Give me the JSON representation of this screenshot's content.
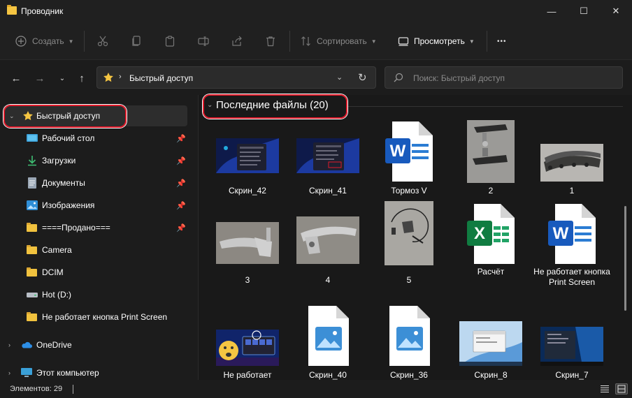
{
  "window": {
    "title": "Проводник",
    "minimize_glyph": "—",
    "maximize_glyph": "☐",
    "close_glyph": "✕"
  },
  "toolbar": {
    "create_label": "Создать",
    "sort_label": "Сортировать",
    "view_label": "Просмотреть",
    "more_glyph": "•••"
  },
  "address": {
    "path": "Быстрый доступ",
    "search_placeholder": "Поиск: Быстрый доступ"
  },
  "sidebar": {
    "quick_access": "Быстрый доступ",
    "items": [
      {
        "label": "Рабочий стол",
        "icon": "desktop-icon",
        "pinned": true
      },
      {
        "label": "Загрузки",
        "icon": "download-icon",
        "pinned": true
      },
      {
        "label": "Документы",
        "icon": "document-icon",
        "pinned": true
      },
      {
        "label": "Изображения",
        "icon": "pictures-icon",
        "pinned": true
      },
      {
        "label": "====Продано===",
        "icon": "folder-icon",
        "pinned": true
      },
      {
        "label": "Camera",
        "icon": "folder-icon",
        "pinned": false
      },
      {
        "label": "DCIM",
        "icon": "folder-icon",
        "pinned": false
      },
      {
        "label": "Hot (D:)",
        "icon": "drive-icon",
        "pinned": false
      },
      {
        "label": "Не работает кнопка Print Screen",
        "icon": "folder-icon",
        "pinned": false
      }
    ],
    "onedrive": "OneDrive",
    "this_pc": "Этот компьютер"
  },
  "content": {
    "group_title": "Последние файлы (20)",
    "files": [
      {
        "name": "Скрин_42",
        "kind": "screenshot"
      },
      {
        "name": "Скрин_41",
        "kind": "screenshot"
      },
      {
        "name": "Тормоз V",
        "kind": "word"
      },
      {
        "name": "2",
        "kind": "photo"
      },
      {
        "name": "1",
        "kind": "photo"
      },
      {
        "name": "3",
        "kind": "photo"
      },
      {
        "name": "4",
        "kind": "photo"
      },
      {
        "name": "5",
        "kind": "photo"
      },
      {
        "name": "Расчёт",
        "kind": "excel"
      },
      {
        "name": "Не работает кнопка Print Screen",
        "kind": "word"
      },
      {
        "name": "Не работает",
        "kind": "screenshot"
      },
      {
        "name": "Скрин_40",
        "kind": "image"
      },
      {
        "name": "Скрин_36",
        "kind": "image"
      },
      {
        "name": "Скрин_8",
        "kind": "screenshot"
      },
      {
        "name": "Скрин_7",
        "kind": "screenshot"
      }
    ]
  },
  "status": {
    "items_count": "Элементов: 29"
  },
  "colors": {
    "accent": "#e01a2a",
    "folder": "#f1c23e",
    "word": "#185abd",
    "excel": "#107c41"
  }
}
